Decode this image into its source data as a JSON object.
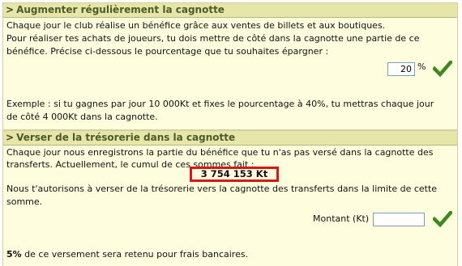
{
  "section1": {
    "title": "Augmenter régulièrement la cagnotte",
    "line1": "Chaque jour le club réalise un bénéfice grâce aux ventes de billets et aux boutiques.",
    "line2": "Pour réaliser tes achats de joueurs, tu dois mettre de côté dans la cagnotte une partie de ce",
    "line3": "bénéfice. Précise ci-dessous le pourcentage que tu souhaites épargner :",
    "percent_value": "20",
    "percent_unit": "%",
    "example1": "Exemple : si tu gagnes par jour 10 000Kt et fixes le pourcentage à 40%, tu mettras chaque jour",
    "example2": "de côté 4 000Kt dans la cagnotte."
  },
  "section2": {
    "title": "Verser de la trésorerie dans la cagnotte",
    "line1": "Chaque jour nous enregistrons la partie du bénéfice que tu n'as pas versé dans la cagnotte des",
    "line2": "transferts. Actuellement, le cumul de ces sommes fait :",
    "amount": "3 754 153 Kt",
    "line3": "Nous t'autorisons à verser de la trésorerie vers la cagnotte des transferts dans la limite de cette",
    "line4": "somme.",
    "montant_label": "Montant (Kt)",
    "montant_value": "",
    "fee_pct": "5%",
    "fee_text": " de ce versement sera retenu pour frais bancaires."
  },
  "colors": {
    "panel_bg": "#fefede",
    "header_bg": "#e6e6a8",
    "header_text": "#4d5b2a",
    "highlight_border": "#d61818",
    "check_green": "#3c8a1e"
  }
}
